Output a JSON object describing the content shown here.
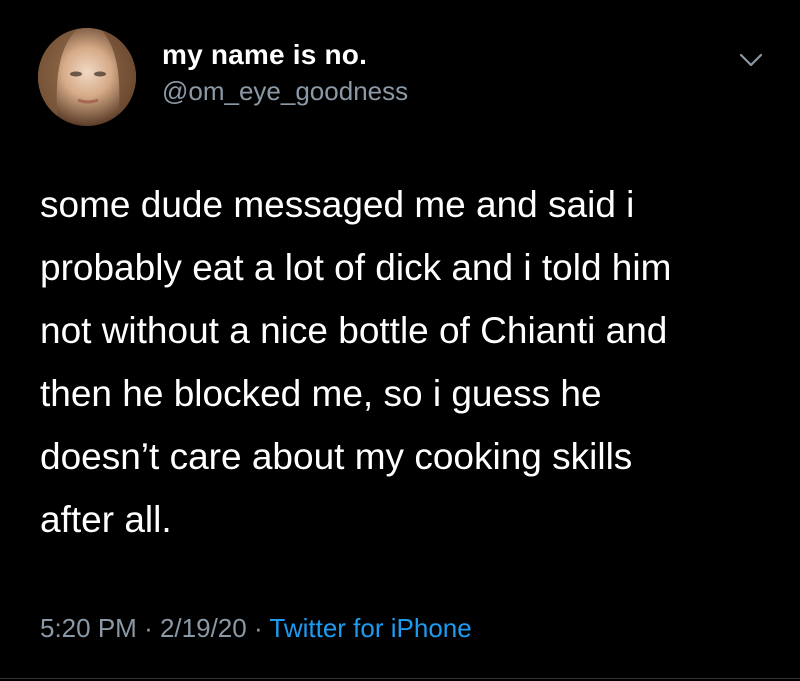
{
  "header": {
    "display_name": "my name is no.",
    "handle": "@om_eye_goodness",
    "avatar_icon": "profile-photo",
    "menu_icon": "chevron-down-icon"
  },
  "tweet": {
    "lines": [
      "some dude messaged me and said i",
      "probably eat a lot of dick and i told him",
      "not without a nice bottle of Chianti and",
      "then he blocked me, so i guess he",
      "doesn’t care about my cooking skills",
      "after all."
    ]
  },
  "meta": {
    "time": "5:20 PM",
    "separator": "·",
    "date": "2/19/20",
    "source": "Twitter for iPhone"
  },
  "colors": {
    "background": "#000000",
    "text": "#ffffff",
    "secondary_text": "#8b98a5",
    "link": "#1d9bf0"
  }
}
